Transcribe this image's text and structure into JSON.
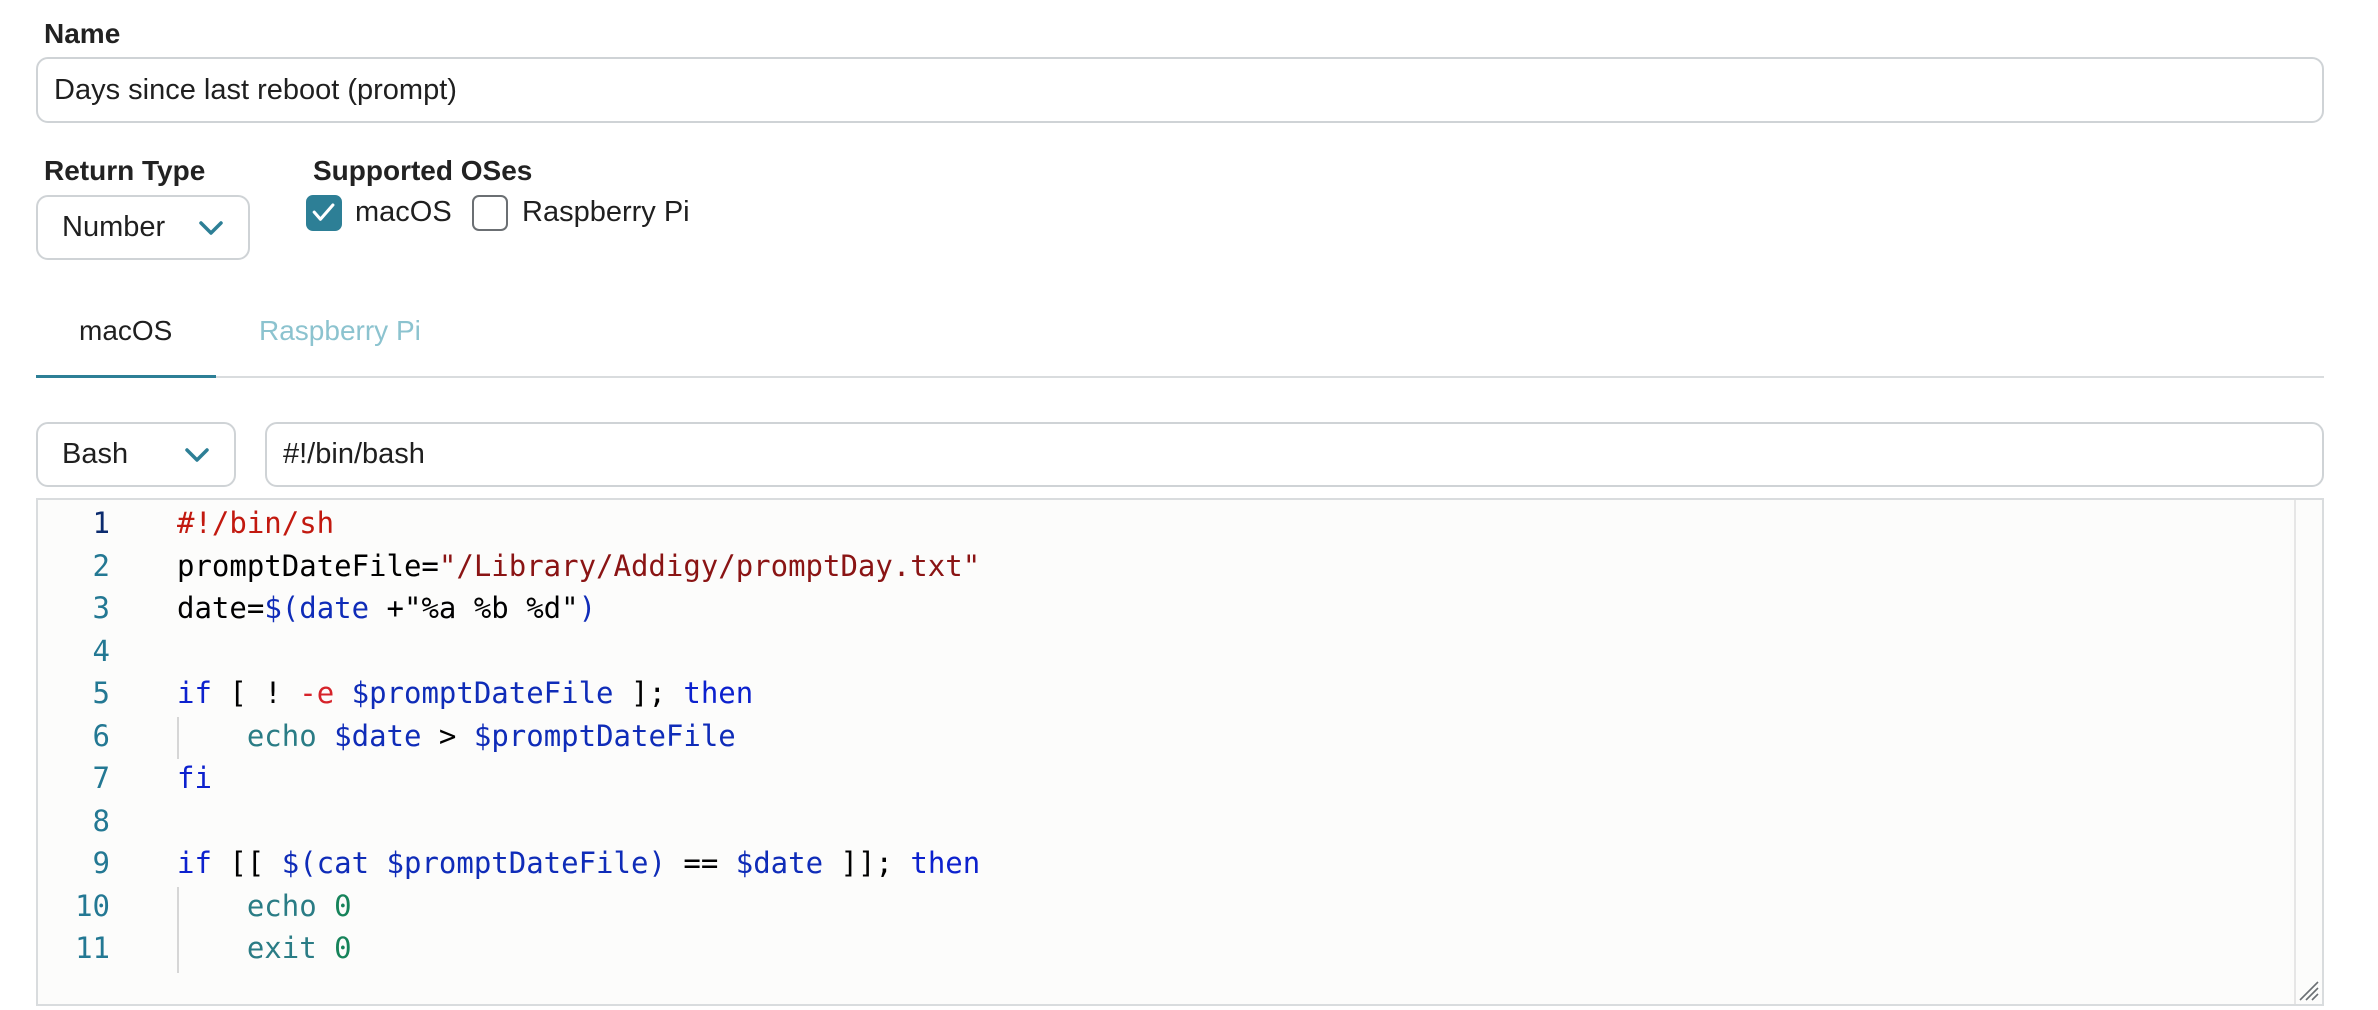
{
  "form": {
    "name_label": "Name",
    "name_value": "Days since last reboot (prompt)",
    "return_type_label": "Return Type",
    "return_type_value": "Number",
    "supported_oses_label": "Supported OSes",
    "oses": [
      {
        "label": "macOS",
        "checked": true
      },
      {
        "label": "Raspberry Pi",
        "checked": false
      }
    ]
  },
  "tabs": [
    {
      "label": "macOS",
      "active": true
    },
    {
      "label": "Raspberry Pi",
      "active": false
    }
  ],
  "script": {
    "language_value": "Bash",
    "interpreter_value": "#!/bin/bash"
  },
  "editor": {
    "line_numbers": [
      "1",
      "2",
      "3",
      "4",
      "5",
      "6",
      "7",
      "8",
      "9",
      "10",
      "11"
    ],
    "lines": [
      "#!/bin/sh",
      "promptDateFile=\"/Library/Addigy/promptDay.txt\"",
      "date=$(date +\"%a %b %d\")",
      "",
      "if [ ! -e $promptDateFile ]; then",
      "    echo $date > $promptDateFile",
      "fi",
      "",
      "if [[ $(cat $promptDateFile) == $date ]]; then",
      "    echo 0",
      "    exit 0"
    ]
  },
  "colors": {
    "accent": "#2d7f96",
    "inactive_tab": "#8cc3cf",
    "line_number": "#237893",
    "keyword": "#0c21ce",
    "string": "#8a1414",
    "comment": "#c2190f"
  }
}
